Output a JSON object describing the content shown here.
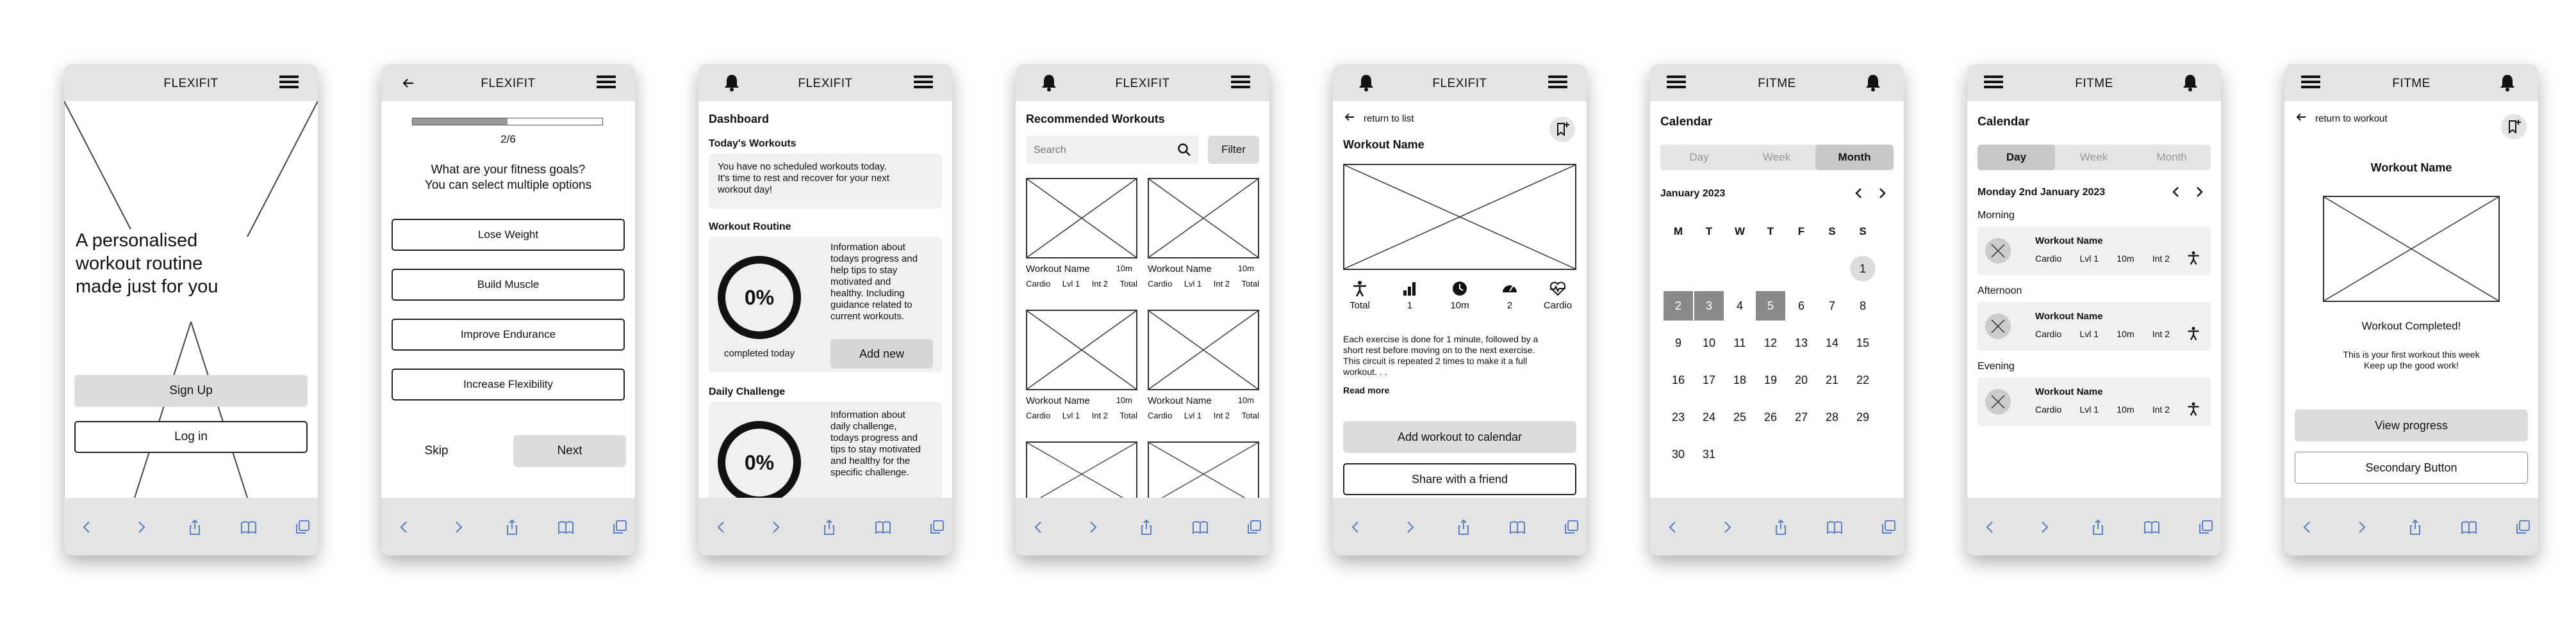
{
  "screen1": {
    "title": "FLEXIFIT",
    "tagline": [
      "A personalised",
      "workout routine",
      "made just for you"
    ],
    "signup_label": "Sign Up",
    "login_label": "Log in"
  },
  "screen2": {
    "title": "FLEXIFIT",
    "progress": 0.5,
    "step": "2/6",
    "question": [
      "What are your fitness goals?",
      "You can select multiple options"
    ],
    "options": [
      "Lose Weight",
      "Build Muscle",
      "Improve Endurance",
      "Increase Flexibility"
    ],
    "skip_label": "Skip",
    "next_label": "Next"
  },
  "screen3": {
    "title": "FLEXIFIT",
    "dashboard": "Dashboard",
    "todays_workouts": "Today's Workouts",
    "todays_text": [
      "You have no scheduled workouts today.",
      "It's time to rest and recover for your next",
      "workout day!"
    ],
    "routine_title": "Workout Routine",
    "routine_percent": "0%",
    "routine_caption": "completed today",
    "routine_info": [
      "Information about",
      "todays progress and",
      "help tips to stay",
      "motivated and",
      "healthy. Including",
      "guidance related to",
      "current workouts."
    ],
    "add_new_label": "Add new",
    "challenge_title": "Daily Challenge",
    "challenge_percent": "0%",
    "challenge_info": [
      "Information about",
      "daily challenge,",
      "todays progress and",
      "tips to stay motivated",
      "and healthy for the",
      "specific challenge."
    ]
  },
  "screen4": {
    "title": "FLEXIFIT",
    "heading": "Recommended Workouts",
    "search_placeholder": "Search",
    "filter_label": "Filter",
    "cards": [
      {
        "name": "Workout Name",
        "duration": "10m",
        "tags": [
          "Cardio",
          "Lvl 1",
          "Int 2",
          "Total"
        ]
      },
      {
        "name": "Workout Name",
        "duration": "10m",
        "tags": [
          "Cardio",
          "Lvl 1",
          "Int 2",
          "Total"
        ]
      },
      {
        "name": "Workout Name",
        "duration": "10m",
        "tags": [
          "Cardio",
          "Lvl 1",
          "Int 2",
          "Total"
        ]
      },
      {
        "name": "Workout Name",
        "duration": "10m",
        "tags": [
          "Cardio",
          "Lvl 1",
          "Int 2",
          "Total"
        ]
      }
    ]
  },
  "screen5": {
    "title": "FLEXIFIT",
    "back_label": "return to list",
    "workout_name": "Workout Name",
    "stats": [
      "Total",
      "1",
      "10m",
      "2",
      "Cardio"
    ],
    "description": [
      "Each exercise is done for 1 minute, followed by a",
      "short rest before moving on to the next exercise.",
      "This circuit is repeated 2 times to make it a full",
      "workout. . ."
    ],
    "read_more": "Read more",
    "add_calendar_label": "Add workout to calendar",
    "share_label": "Share with a friend"
  },
  "screen6": {
    "title": "FITME",
    "heading": "Calendar",
    "segments": [
      "Day",
      "Week",
      "Month"
    ],
    "active_segment": 2,
    "month": "January 2023",
    "weekdays": [
      "M",
      "T",
      "W",
      "T",
      "F",
      "S",
      "S"
    ],
    "weeks": [
      [
        "",
        "",
        "",
        "",
        "",
        "",
        "1"
      ],
      [
        "2",
        "3",
        "4",
        "5",
        "6",
        "7",
        "8"
      ],
      [
        "9",
        "10",
        "11",
        "12",
        "13",
        "14",
        "15"
      ],
      [
        "16",
        "17",
        "18",
        "19",
        "20",
        "21",
        "22"
      ],
      [
        "23",
        "24",
        "25",
        "26",
        "27",
        "28",
        "29"
      ],
      [
        "30",
        "31",
        "",
        "",
        "",
        "",
        ""
      ]
    ]
  },
  "screen7": {
    "title": "FITME",
    "heading": "Calendar",
    "segments": [
      "Day",
      "Week",
      "Month"
    ],
    "active_segment": 0,
    "date": "Monday 2nd January 2023",
    "periods": [
      {
        "label": "Morning",
        "name": "Workout Name",
        "tags": [
          "Cardio",
          "Lvl 1",
          "10m",
          "Int 2"
        ]
      },
      {
        "label": "Afternoon",
        "name": "Workout Name",
        "tags": [
          "Cardio",
          "Lvl 1",
          "10m",
          "Int 2"
        ]
      },
      {
        "label": "Evening",
        "name": "Workout Name",
        "tags": [
          "Cardio",
          "Lvl 1",
          "10m",
          "Int 2"
        ]
      }
    ]
  },
  "screen8": {
    "title": "FITME",
    "back_label": "return to workout",
    "workout_name": "Workout Name",
    "completed": "Workout Completed!",
    "message": [
      "This is your first workout this week",
      "Keep up the good work!"
    ],
    "view_progress_label": "View progress",
    "secondary_label": "Secondary Button"
  }
}
